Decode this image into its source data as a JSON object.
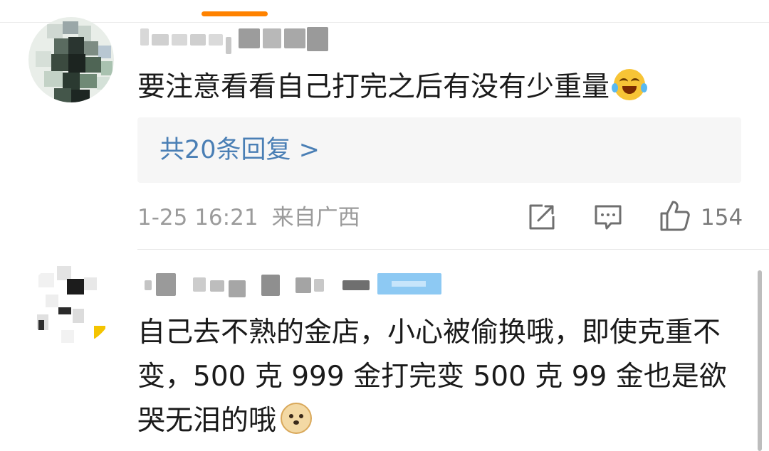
{
  "colors": {
    "tab_indicator": "#ff8200",
    "reply_link": "#4a7fb5",
    "meta_text": "#9b9b9b",
    "scrollbar": "#bdbdbd"
  },
  "comments": [
    {
      "username": "[blurred]",
      "avatar": "avatar-mosaic",
      "text": "要注意看看自己打完之后有没有少重量",
      "emoji": "laugh-cry-icon",
      "replies_link": "共20条回复 >",
      "time": "1-25 16:21",
      "location": "来自广西",
      "actions": {
        "share_icon": "share-icon",
        "comment_icon": "comment-icon",
        "like_icon": "like-icon",
        "like_count": "154"
      }
    },
    {
      "username": "[blurred]",
      "avatar": "avatar-mosaic",
      "text": "自己去不熟的金店，小心被偷换哦，即使克重不变，500 克 999 金打完变 500 克 99 金也是欲哭无泪的哦",
      "emoji": "doge-icon"
    }
  ]
}
